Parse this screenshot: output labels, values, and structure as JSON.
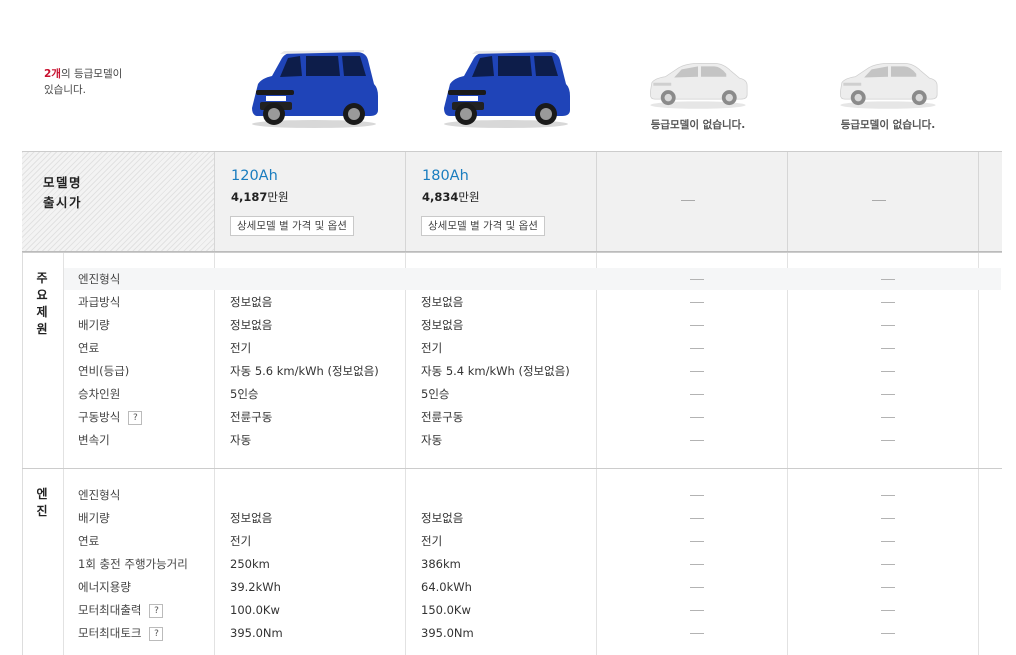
{
  "summary": {
    "count": "2개",
    "text1": "의 등급모델이",
    "text2": "있습니다."
  },
  "no_model_text": "등급모델이 없습니다.",
  "header": {
    "model_name_label": "모델명",
    "price_label": "출시가"
  },
  "models": [
    {
      "name": "120Ah",
      "price_num": "4,187",
      "price_unit": "만원",
      "detail_label": "상세모델 별 가격 및 옵션"
    },
    {
      "name": "180Ah",
      "price_num": "4,834",
      "price_unit": "만원",
      "detail_label": "상세모델 별 가격 및 옵션"
    }
  ],
  "help_glyph": "?",
  "sections": [
    {
      "label": "주요제원",
      "rows": [
        {
          "label": "엔진형식",
          "values": [
            "",
            ""
          ]
        },
        {
          "label": "과급방식",
          "values": [
            "정보없음",
            "정보없음"
          ]
        },
        {
          "label": "배기량",
          "values": [
            "정보없음",
            "정보없음"
          ]
        },
        {
          "label": "연료",
          "values": [
            "전기",
            "전기"
          ]
        },
        {
          "label": "연비(등급)",
          "values": [
            "자동 5.6 km/kWh (정보없음)",
            "자동 5.4 km/kWh (정보없음)"
          ]
        },
        {
          "label": "승차인원",
          "values": [
            "5인승",
            "5인승"
          ]
        },
        {
          "label": "구동방식",
          "values": [
            "전륜구동",
            "전륜구동"
          ],
          "help": true
        },
        {
          "label": "변속기",
          "values": [
            "자동",
            "자동"
          ]
        }
      ]
    },
    {
      "label": "엔진",
      "rows": [
        {
          "label": "엔진형식",
          "values": [
            "",
            ""
          ]
        },
        {
          "label": "배기량",
          "values": [
            "정보없음",
            "정보없음"
          ]
        },
        {
          "label": "연료",
          "values": [
            "전기",
            "전기"
          ]
        },
        {
          "label": "1회 충전 주행가능거리",
          "values": [
            "250km",
            "386km"
          ]
        },
        {
          "label": "에너지용량",
          "values": [
            "39.2kWh",
            "64.0kWh"
          ]
        },
        {
          "label": "모터최대출력",
          "values": [
            "100.0Kw",
            "150.0Kw"
          ],
          "help": true
        },
        {
          "label": "모터최대토크",
          "values": [
            "395.0Nm",
            "395.0Nm"
          ],
          "help": true
        }
      ]
    }
  ],
  "colors": {
    "accent_blue": "#1a7dbf",
    "count_red": "#c8102e",
    "car_blue": "#1f44b8"
  }
}
